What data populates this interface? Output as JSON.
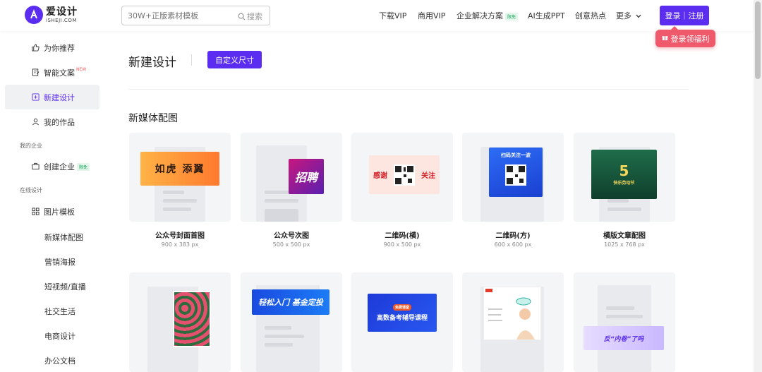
{
  "header": {
    "logo_cn": "爱设计",
    "logo_en": "iSHEJI.COM",
    "search_placeholder": "30W+正版素材模板",
    "search_button": "搜索",
    "nav": {
      "download_vip": "下载VIP",
      "commercial_vip": "商用VIP",
      "enterprise": "企业解决方案",
      "enterprise_badge": "限免",
      "ai_ppt": "AI生成PPT",
      "hot": "创意热点",
      "more": "更多"
    },
    "login_button": "登录｜注册",
    "tooltip": "登录领福利"
  },
  "sidebar": {
    "recommend": "为你推荐",
    "smart_copy": "智能文案",
    "smart_copy_tag": "NEW",
    "new_design": "新建设计",
    "my_works": "我的作品",
    "section_enterprise": "我的企业",
    "create_enterprise": "创建企业",
    "create_enterprise_badge": "限免",
    "section_online": "在线设计",
    "image_templates": "图片模板",
    "subitems": [
      "新媒体配图",
      "营销海报",
      "短视频/直播",
      "社交生活",
      "电商设计",
      "办公文档"
    ]
  },
  "main": {
    "title": "新建设计",
    "custom_size_button": "自定义尺寸",
    "section_title": "新媒体配图",
    "cards": [
      {
        "name": "公众号封面首图",
        "size": "900 x 383 px"
      },
      {
        "name": "公众号次图",
        "size": "500 x 500 px"
      },
      {
        "name": "二维码(横)",
        "size": "900 x 500 px"
      },
      {
        "name": "二维码(方)",
        "size": "600 x 600 px"
      },
      {
        "name": "横版文章配图",
        "size": "1025 x 768 px"
      }
    ],
    "thumbs": {
      "t1": "如虎 添翼",
      "t2": "招聘",
      "t3_left": "感谢",
      "t3_right": "关注",
      "t4": "扫码关注一波",
      "t5_big": "5",
      "t5_text": "快乐劳动节",
      "t7": "轻松入门 基金定投",
      "t8_tag": "免费课堂",
      "t8": "高数备考辅导课程",
      "t10": "反“内卷”了吗"
    }
  },
  "colors": {
    "brand": "#5b2df0",
    "tooltip": "#ee5a6c",
    "badge_green": "#1aa35c"
  }
}
